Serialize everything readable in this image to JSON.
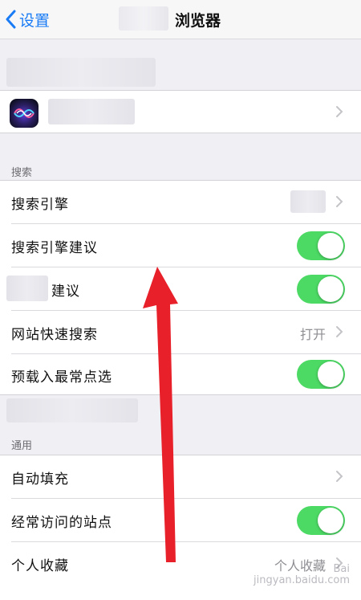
{
  "navbar": {
    "back_label": "设置",
    "title": "浏览器"
  },
  "search_section": {
    "header": "搜索"
  },
  "rows": {
    "search_engine": {
      "label": "搜索引擎"
    },
    "search_engine_suggestions": {
      "label": "搜索引擎建议",
      "toggle": "on"
    },
    "suggestions": {
      "label": "建议",
      "toggle": "on"
    },
    "quick_website_search": {
      "label": "网站快速搜索",
      "value": "打开"
    },
    "preload_top_hit": {
      "label": "预载入最常点选",
      "toggle": "on"
    },
    "autofill": {
      "label": "自动填充"
    },
    "frequently_visited": {
      "label": "经常访问的站点",
      "toggle": "on"
    },
    "favorites": {
      "label": "个人收藏",
      "value": "个人收藏"
    }
  },
  "general_section": {
    "header": "通用"
  },
  "colors": {
    "accent": "#1a7cf5",
    "toggle_on": "#4cd964",
    "arrow": "#e8202a"
  },
  "watermark": {
    "line1": "Bai",
    "line2": "jingyan.baidu.com"
  }
}
